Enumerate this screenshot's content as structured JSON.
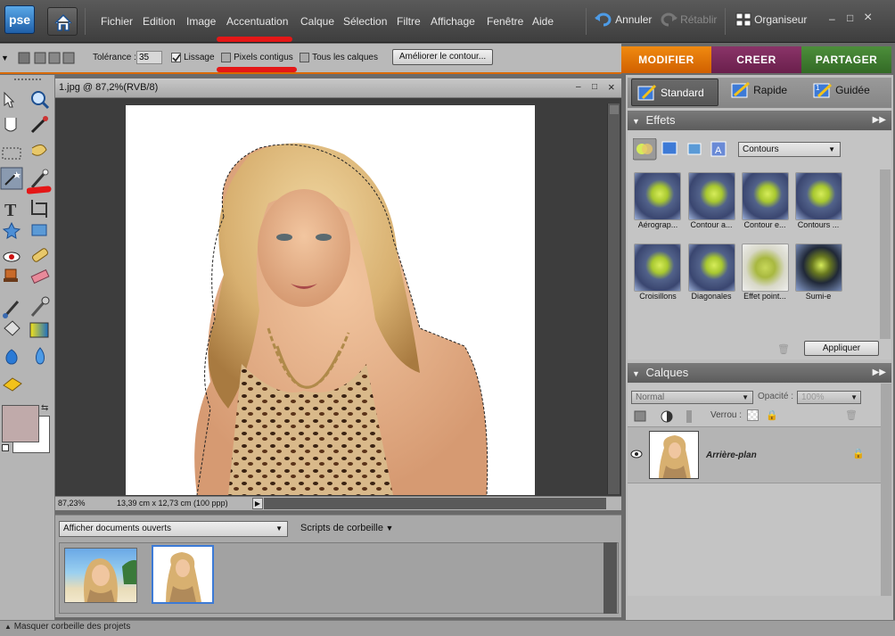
{
  "app": {
    "logo": "pse"
  },
  "menu": [
    "Fichier",
    "Edition",
    "Image",
    "Accentuation",
    "Calque",
    "Sélection",
    "Filtre",
    "Affichage",
    "Fenêtre",
    "Aide"
  ],
  "toolbar": {
    "undo": "Annuler",
    "redo": "Rétablir",
    "organizer": "Organiseur",
    "win_min": "–",
    "win_max": "□",
    "win_close": "×"
  },
  "options": {
    "tolerance_label": "Tolérance :",
    "tolerance_value": "35",
    "antialias": "Lissage",
    "contiguous": "Pixels contigus",
    "all_layers": "Tous les calques",
    "refine_edge": "Améliorer le contour..."
  },
  "modes": [
    "MODIFIER",
    "CREER",
    "PARTAGER"
  ],
  "edit_modes": [
    "Standard",
    "Rapide",
    "Guidée"
  ],
  "document": {
    "title": "1.jpg @ 87,2%(RVB/8)",
    "zoom": "87,23%",
    "info": "13,39 cm x 12,73 cm (100 ppp)"
  },
  "bin": {
    "select": "Afficher documents ouverts",
    "scripts": "Scripts de corbeille"
  },
  "effects": {
    "title": "Effets",
    "category": "Contours",
    "items": [
      "Aérograp...",
      "Contour a...",
      "Contour e...",
      "Contours ...",
      "Croisillons",
      "Diagonales",
      "Effet point...",
      "Sumi-e"
    ],
    "apply": "Appliquer"
  },
  "layers": {
    "title": "Calques",
    "blend": "Normal",
    "opacity_label": "Opacité :",
    "opacity_value": "100%",
    "lock_label": "Verrou :",
    "layer_name": "Arrière-plan"
  },
  "footer": {
    "hide_bin": "Masquer corbeille des projets"
  },
  "colors": {
    "accent_orange": "#e07800",
    "create_purple": "#7a2a5a",
    "share_green": "#3f7f2f",
    "annotation_red": "#e41717"
  }
}
